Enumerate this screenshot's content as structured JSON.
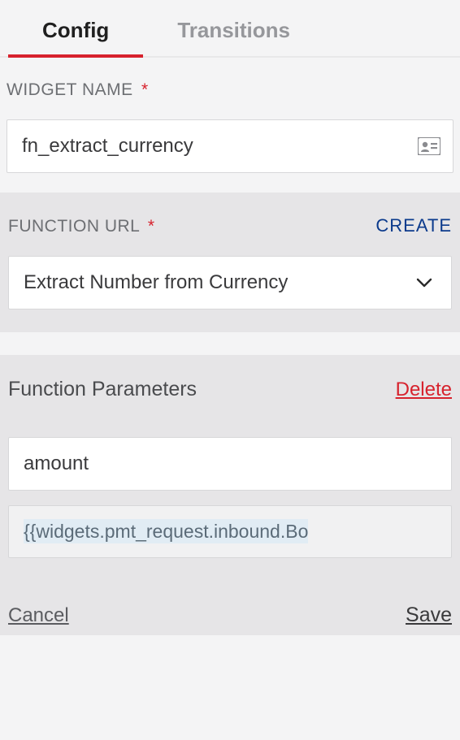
{
  "tabs": {
    "config": "Config",
    "transitions": "Transitions"
  },
  "widgetName": {
    "label": "WIDGET NAME",
    "required": "*",
    "value": "fn_extract_currency"
  },
  "functionUrl": {
    "label": "FUNCTION URL",
    "required": "*",
    "createLabel": "CREATE",
    "selected": "Extract Number from Currency"
  },
  "functionParams": {
    "title": "Function Parameters",
    "deleteLabel": "Delete",
    "keyValue": "amount",
    "valueValue": "{{widgets.pmt_request.inbound.Bo"
  },
  "footer": {
    "cancel": "Cancel",
    "save": "Save"
  }
}
